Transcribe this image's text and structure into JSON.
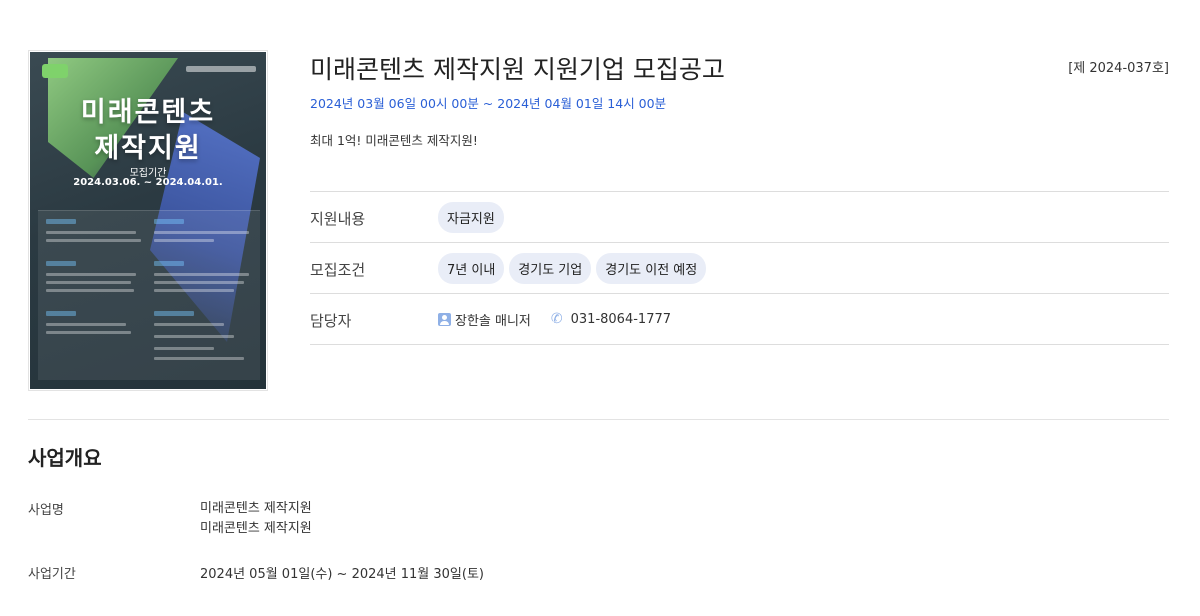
{
  "poster": {
    "title_line1": "미래콘텐츠",
    "title_line2": "제작지원",
    "period_label": "모집기간",
    "period_dates": "2024.03.06. ~ 2024.04.01."
  },
  "notice": {
    "title": "미래콘텐츠 제작지원 지원기업 모집공고",
    "number": "[제 2024-037호]",
    "period": "2024년 03월 06일 00시 00분 ~ 2024년 04월 01일 14시 00분",
    "summary": "최대 1억! 미래콘텐츠 제작지원!"
  },
  "info": {
    "support": {
      "label": "지원내용",
      "chips": [
        "자금지원"
      ]
    },
    "conditions": {
      "label": "모집조건",
      "chips": [
        "7년 이내",
        "경기도 기업",
        "경기도 이전 예정"
      ]
    },
    "contact": {
      "label": "담당자",
      "person": "장한솔 매니저",
      "phone": "031-8064-1777"
    }
  },
  "overview": {
    "section_title": "사업개요",
    "name_label": "사업명",
    "name_values": [
      "미래콘텐츠 제작지원",
      "미래콘텐츠 제작지원"
    ],
    "period_label": "사업기간",
    "period_value": "2024년 05월 01일(수) ~ 2024년 11월 30일(토)"
  },
  "colors": {
    "accent": "#2a5fd6",
    "chip_bg": "#e9edf7",
    "icon": "#8fb0e6"
  }
}
